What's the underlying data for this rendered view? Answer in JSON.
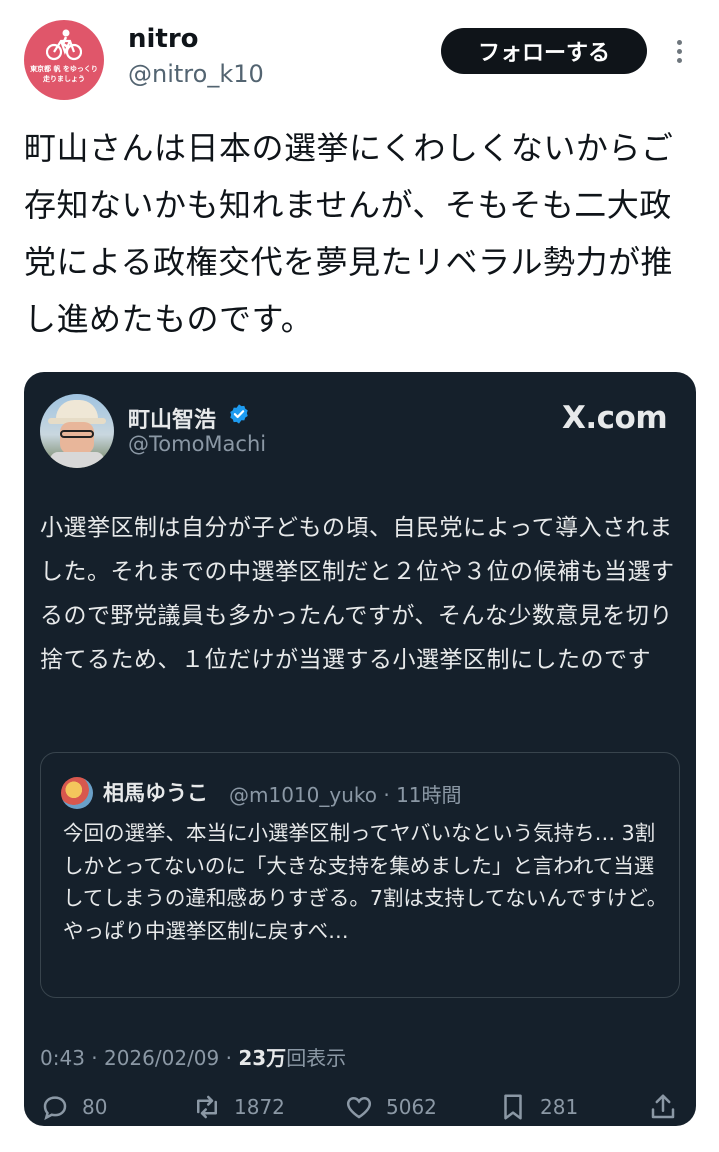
{
  "author": {
    "name": "nitro",
    "handle": "@nitro_k10",
    "avatar_text": "東京都 帆 をゆっくり 走りましょう"
  },
  "follow_label": "フォローする",
  "tweet_text": "町山さんは日本の選挙にくわしくないからご存知ないかも知れませんが、そもそも二大政党による政権交代を夢見たリベラル勢力が推し進めたものです。",
  "card": {
    "name": "町山智浩",
    "handle": "@TomoMachi",
    "source": "X.com",
    "text": "小選挙区制は自分が子どもの頃、自民党によって導入されました。それまでの中選挙区制だと２位や３位の候補も当選するので野党議員も多かったんですが、そんな少数意見を切り捨てるため、１位だけが当選する小選挙区制にしたのです",
    "quote": {
      "name": "相馬ゆうこ",
      "handle_time": "@m1010_yuko · 11時間",
      "text": "今回の選挙、本当に小選挙区制ってヤバいなという気持ち… 3割しかとってないのに「大きな支持を集めました」と言われて当選してしまうの違和感ありすぎる。7割は支持してないんですけど。やっぱり中選挙区制に戻すべ…"
    },
    "meta": {
      "time_date": "0:43 · 2026/02/09 · ",
      "views": "23万",
      "views_label": "回表示"
    },
    "actions": {
      "replies": "80",
      "reposts": "1872",
      "likes": "5062",
      "bookmarks": "281"
    }
  },
  "colors": {
    "card_bg": "#15202b",
    "verified": "#1d9bf0",
    "avatar_bg": "#e0566a"
  }
}
